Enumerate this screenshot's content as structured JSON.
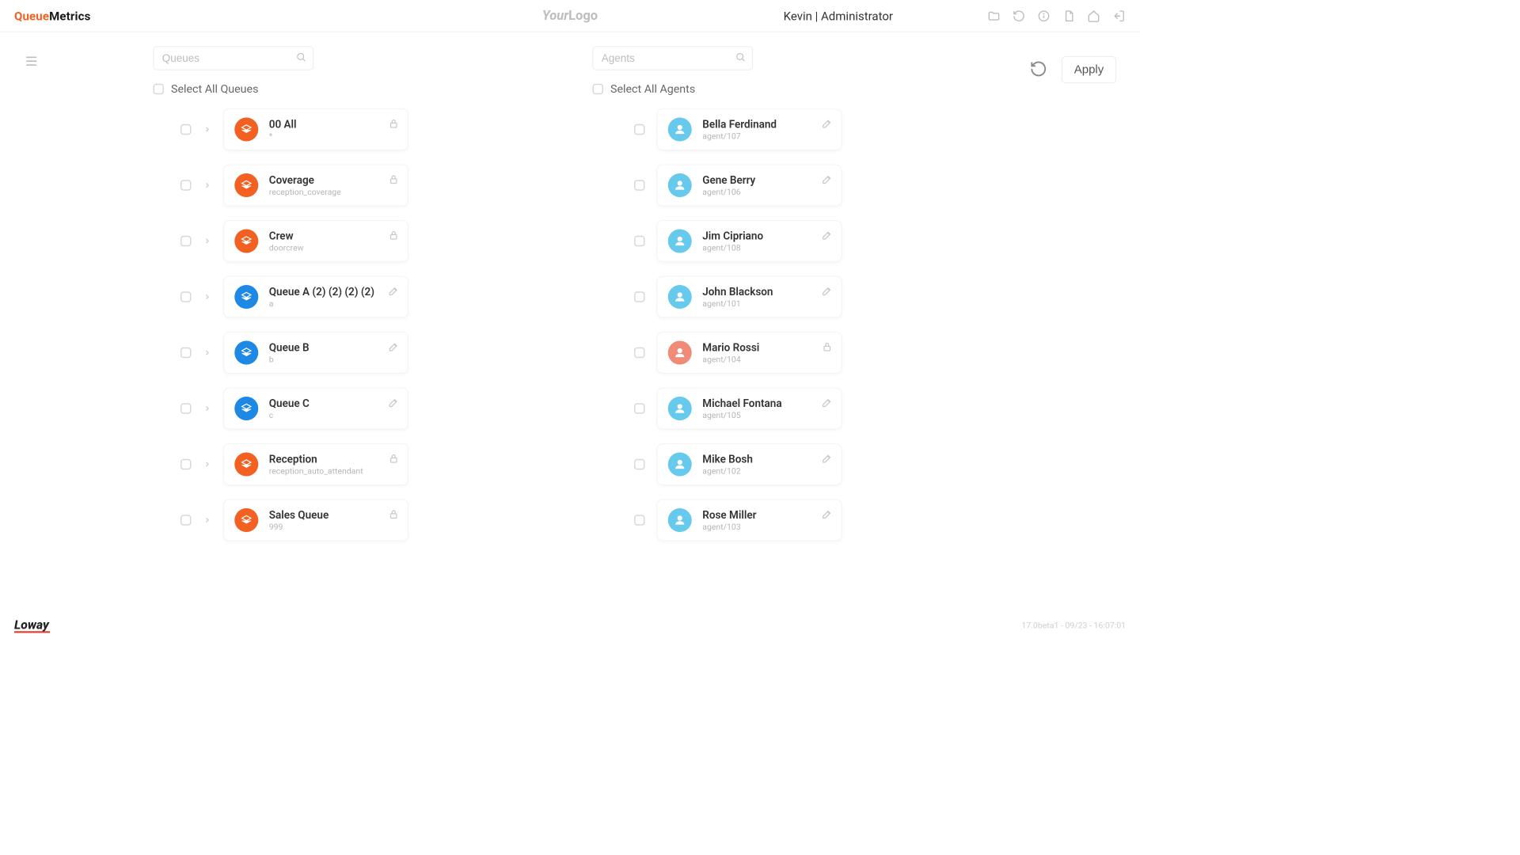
{
  "header": {
    "brand_left": {
      "accent": "Queue",
      "rest": "Metrics"
    },
    "center_logo": {
      "italic": "Your",
      "rest": "Logo"
    },
    "user_label": "Kevin | Administrator"
  },
  "toolbar": {
    "queues_search_placeholder": "Queues",
    "agents_search_placeholder": "Agents",
    "select_all_queues_label": "Select All Queues",
    "select_all_agents_label": "Select All Agents",
    "apply_label": "Apply"
  },
  "queues": [
    {
      "title": "00 All",
      "sub": "*",
      "color": "orange",
      "action": "lock"
    },
    {
      "title": "Coverage",
      "sub": "reception_coverage",
      "color": "orange",
      "action": "lock"
    },
    {
      "title": "Crew",
      "sub": "doorcrew",
      "color": "orange",
      "action": "lock"
    },
    {
      "title": "Queue A (2) (2) (2) (2)",
      "sub": "a",
      "color": "blue",
      "action": "edit"
    },
    {
      "title": "Queue B",
      "sub": "b",
      "color": "blue",
      "action": "edit"
    },
    {
      "title": "Queue C",
      "sub": "c",
      "color": "blue",
      "action": "edit"
    },
    {
      "title": "Reception",
      "sub": "reception_auto_attendant",
      "color": "orange",
      "action": "lock"
    },
    {
      "title": "Sales Queue",
      "sub": "999",
      "color": "orange",
      "action": "lock"
    }
  ],
  "agents": [
    {
      "title": "Bella Ferdinand",
      "sub": "agent/107",
      "color": "cyan",
      "action": "edit"
    },
    {
      "title": "Gene Berry",
      "sub": "agent/106",
      "color": "cyan",
      "action": "edit"
    },
    {
      "title": "Jim Cipriano",
      "sub": "agent/108",
      "color": "cyan",
      "action": "edit"
    },
    {
      "title": "John Blackson",
      "sub": "agent/101",
      "color": "cyan",
      "action": "edit"
    },
    {
      "title": "Mario Rossi",
      "sub": "agent/104",
      "color": "salmon",
      "action": "lock"
    },
    {
      "title": "Michael Fontana",
      "sub": "agent/105",
      "color": "cyan",
      "action": "edit"
    },
    {
      "title": "Mike Bosh",
      "sub": "agent/102",
      "color": "cyan",
      "action": "edit"
    },
    {
      "title": "Rose Miller",
      "sub": "agent/103",
      "color": "cyan",
      "action": "edit"
    }
  ],
  "footer": {
    "brand": "Loway",
    "meta": "17.0beta1 - 09/23 - 16:07:01"
  }
}
